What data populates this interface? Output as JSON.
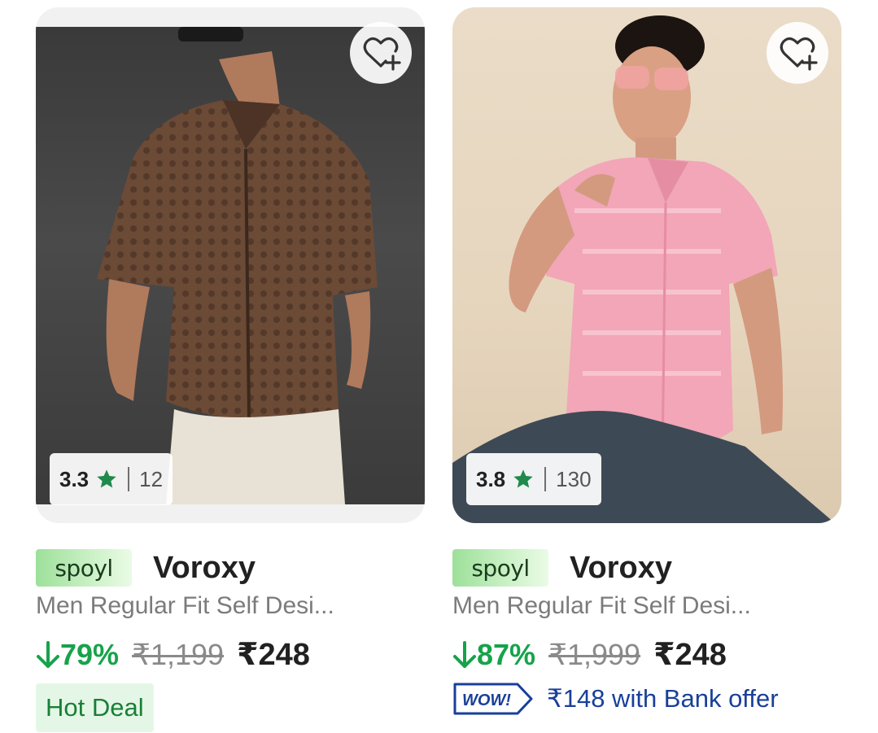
{
  "products": [
    {
      "rating": "3.3",
      "rating_count": "12",
      "seller_logo": "spoyl",
      "brand": "Voroxy",
      "title": "Men Regular Fit Self Desi...",
      "discount": "79%",
      "mrp": "₹1,199",
      "price": "₹248",
      "tag": "Hot Deal"
    },
    {
      "rating": "3.8",
      "rating_count": "130",
      "seller_logo": "spoyl",
      "brand": "Voroxy",
      "title": "Men Regular Fit Self Desi...",
      "discount": "87%",
      "mrp": "₹1,999",
      "price": "₹248",
      "bank_badge": "WOW!",
      "bank_offer": "₹148 with Bank offer"
    }
  ],
  "icons": {
    "wishlist": "heart-plus-icon",
    "rating_star": "star-icon",
    "discount_arrow": "arrow-down-icon"
  },
  "colors": {
    "star": "#1f8a4c",
    "discount": "#16a34a",
    "bank_offer": "#1a3f9a",
    "hot_deal_bg": "#e4f7e6"
  }
}
